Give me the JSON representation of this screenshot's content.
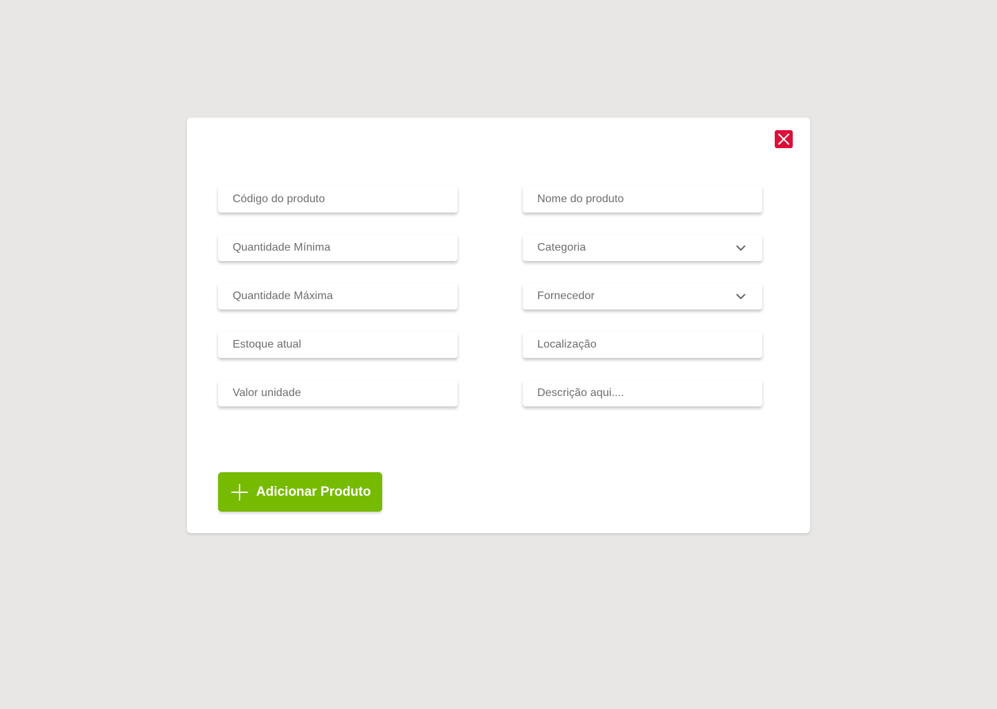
{
  "modal": {
    "close_icon": "close-icon",
    "close_color": "#dc0f3a",
    "fields_left": [
      {
        "placeholder": "Código do produto",
        "type": "text"
      },
      {
        "placeholder": "Quantidade Mínima",
        "type": "text"
      },
      {
        "placeholder": "Quantidade Máxima",
        "type": "text"
      },
      {
        "placeholder": "Estoque atual",
        "type": "text"
      },
      {
        "placeholder": "Valor unidade",
        "type": "text"
      }
    ],
    "fields_right": [
      {
        "placeholder": "Nome do produto",
        "type": "text"
      },
      {
        "placeholder": "Categoria",
        "type": "select",
        "icon": "chevron-down-icon"
      },
      {
        "placeholder": "Fornecedor",
        "type": "select",
        "icon": "chevron-down-icon"
      },
      {
        "placeholder": "Localização",
        "type": "text"
      },
      {
        "placeholder": "Descrição aqui....",
        "type": "text"
      }
    ],
    "add_button": {
      "label": "Adicionar Produto",
      "icon": "plus-icon",
      "color": "#76bb00"
    }
  }
}
